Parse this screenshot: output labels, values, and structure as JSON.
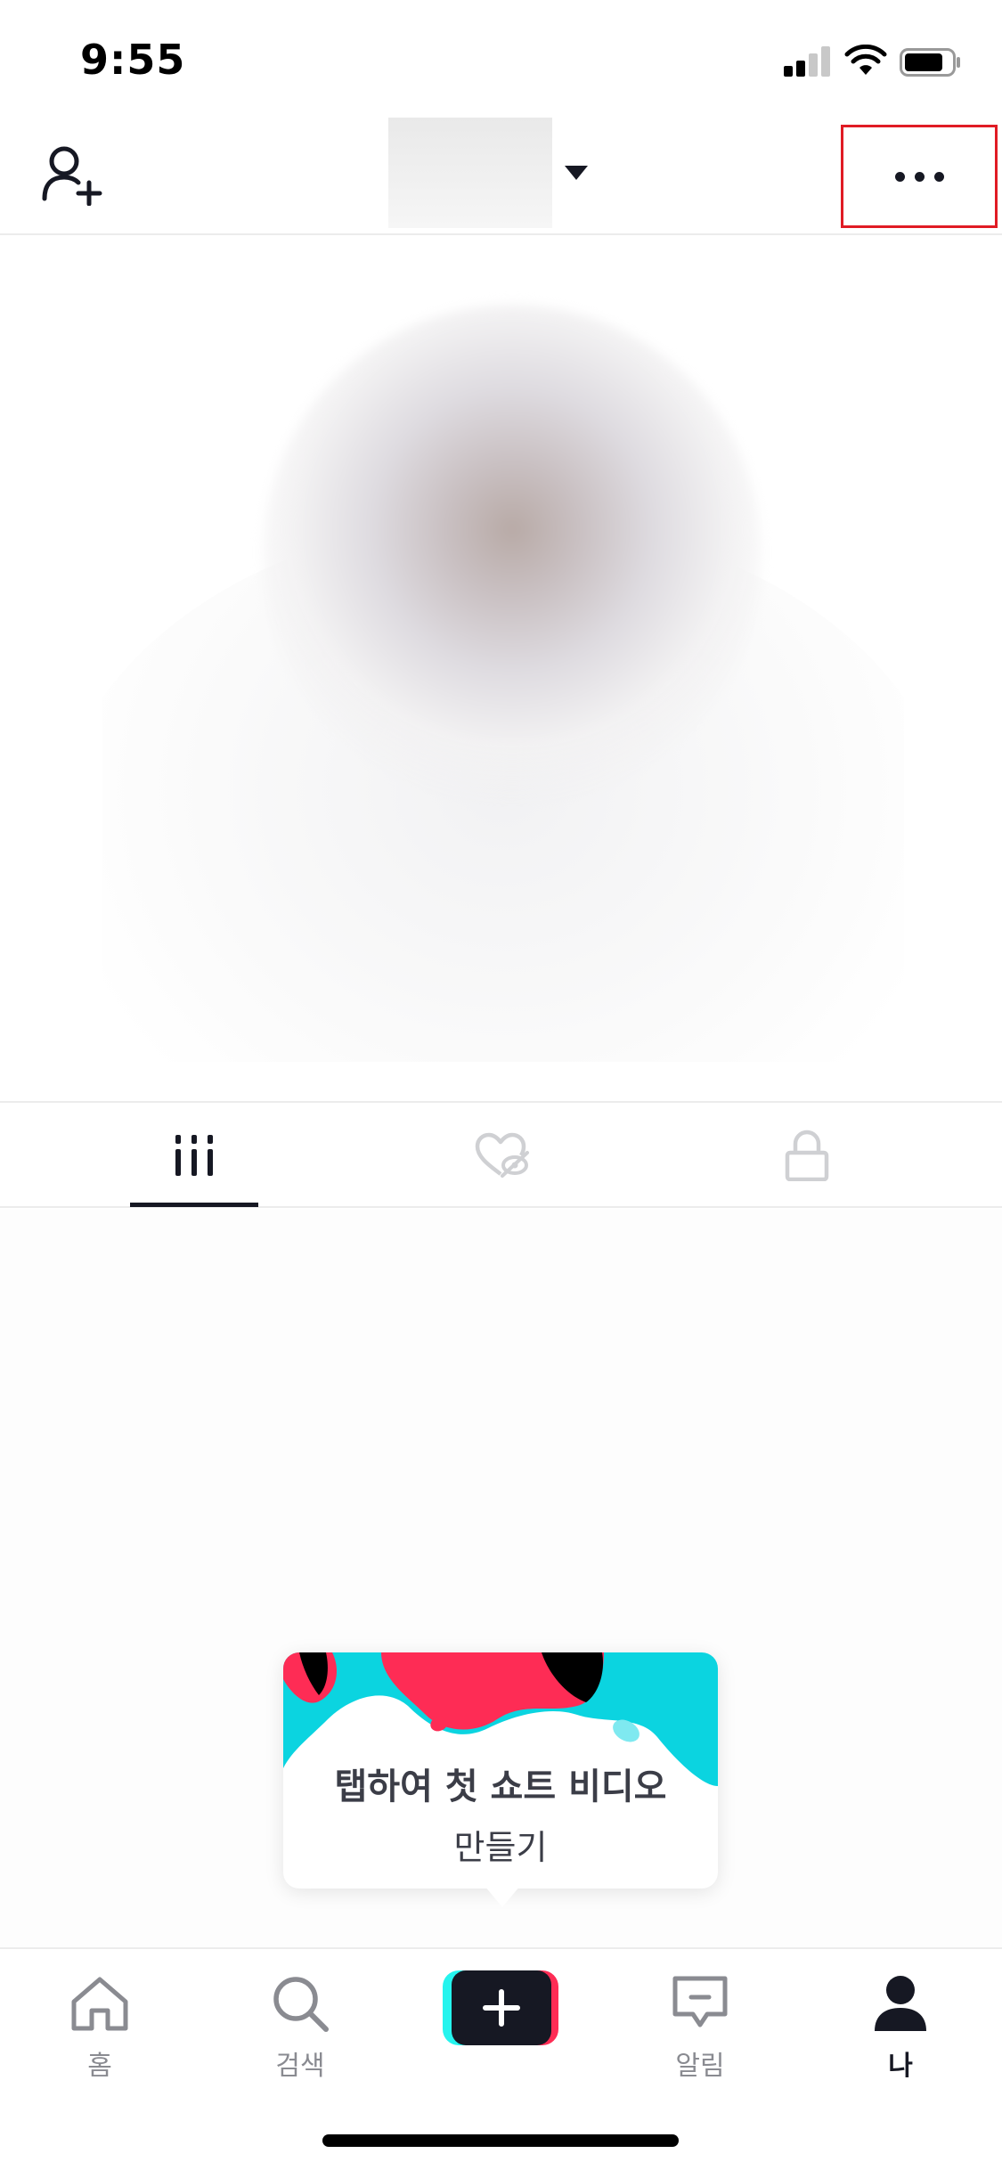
{
  "status_bar": {
    "time": "9:55"
  },
  "header": {
    "add_friend_icon": "person-plus-icon",
    "account_switch_icon": "caret-down-icon",
    "more_icon": "more-horizontal-icon"
  },
  "tabs": [
    {
      "id": "videos",
      "icon": "grid-icon",
      "active": true
    },
    {
      "id": "liked",
      "icon": "hidden-heart-icon",
      "active": false
    },
    {
      "id": "private",
      "icon": "lock-icon",
      "active": false
    }
  ],
  "tooltip": {
    "title": "탭하여 첫 쇼트 비디오",
    "subtitle": "만들기"
  },
  "bottom_nav": {
    "home": "홈",
    "search": "검색",
    "inbox": "알림",
    "me": "나"
  },
  "colors": {
    "text": "#161823",
    "inactive": "#8a8b91",
    "cyan": "#25f4ee",
    "pink": "#fe2c55",
    "highlight_border": "#e01b24"
  }
}
